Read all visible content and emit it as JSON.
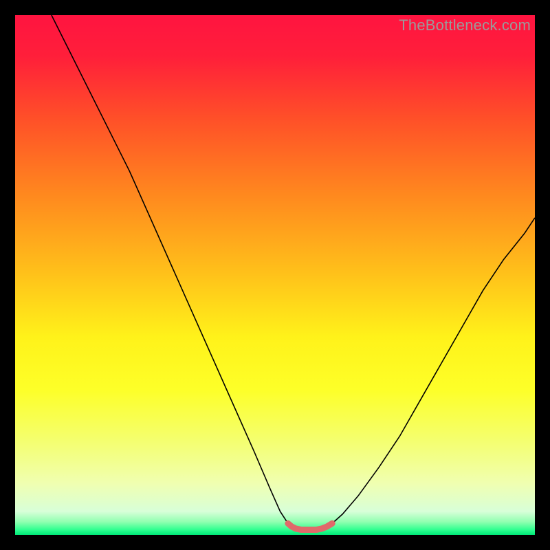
{
  "watermark": "TheBottleneck.com",
  "chart_data": {
    "type": "line",
    "title": "",
    "xlabel": "",
    "ylabel": "",
    "xlim": [
      0,
      100
    ],
    "ylim": [
      0,
      100
    ],
    "background_gradient": {
      "stops": [
        {
          "offset": 0.0,
          "color": "#ff1440"
        },
        {
          "offset": 0.08,
          "color": "#ff1f3a"
        },
        {
          "offset": 0.2,
          "color": "#ff5028"
        },
        {
          "offset": 0.35,
          "color": "#ff8a1e"
        },
        {
          "offset": 0.5,
          "color": "#ffc21a"
        },
        {
          "offset": 0.62,
          "color": "#fff21a"
        },
        {
          "offset": 0.72,
          "color": "#fdff28"
        },
        {
          "offset": 0.82,
          "color": "#f4ff70"
        },
        {
          "offset": 0.9,
          "color": "#f0ffb0"
        },
        {
          "offset": 0.955,
          "color": "#d8ffd8"
        },
        {
          "offset": 0.975,
          "color": "#90ffb0"
        },
        {
          "offset": 0.99,
          "color": "#30ff90"
        },
        {
          "offset": 1.0,
          "color": "#00e878"
        }
      ]
    },
    "series": [
      {
        "name": "left-curve",
        "color": "#000000",
        "width": 1.6,
        "x": [
          7,
          10,
          14,
          18,
          22,
          26,
          30,
          34,
          38,
          42,
          46,
          49,
          51,
          52.5
        ],
        "y": [
          100,
          94,
          86,
          78,
          70,
          61,
          52,
          43,
          34,
          25,
          16,
          9,
          4.5,
          2.2
        ]
      },
      {
        "name": "right-curve",
        "color": "#000000",
        "width": 1.6,
        "x": [
          61,
          63,
          66,
          70,
          74,
          78,
          82,
          86,
          90,
          94,
          98,
          100
        ],
        "y": [
          2.2,
          4,
          7.5,
          13,
          19,
          26,
          33,
          40,
          47,
          53,
          58,
          61
        ]
      },
      {
        "name": "trough-highlight",
        "color": "#e06a6a",
        "width": 9,
        "linecap": "round",
        "x": [
          52.5,
          53.2,
          54,
          55,
          56,
          57,
          58,
          59,
          60,
          61
        ],
        "y": [
          2.2,
          1.6,
          1.2,
          1.0,
          1.0,
          1.0,
          1.0,
          1.2,
          1.6,
          2.2
        ]
      }
    ]
  }
}
